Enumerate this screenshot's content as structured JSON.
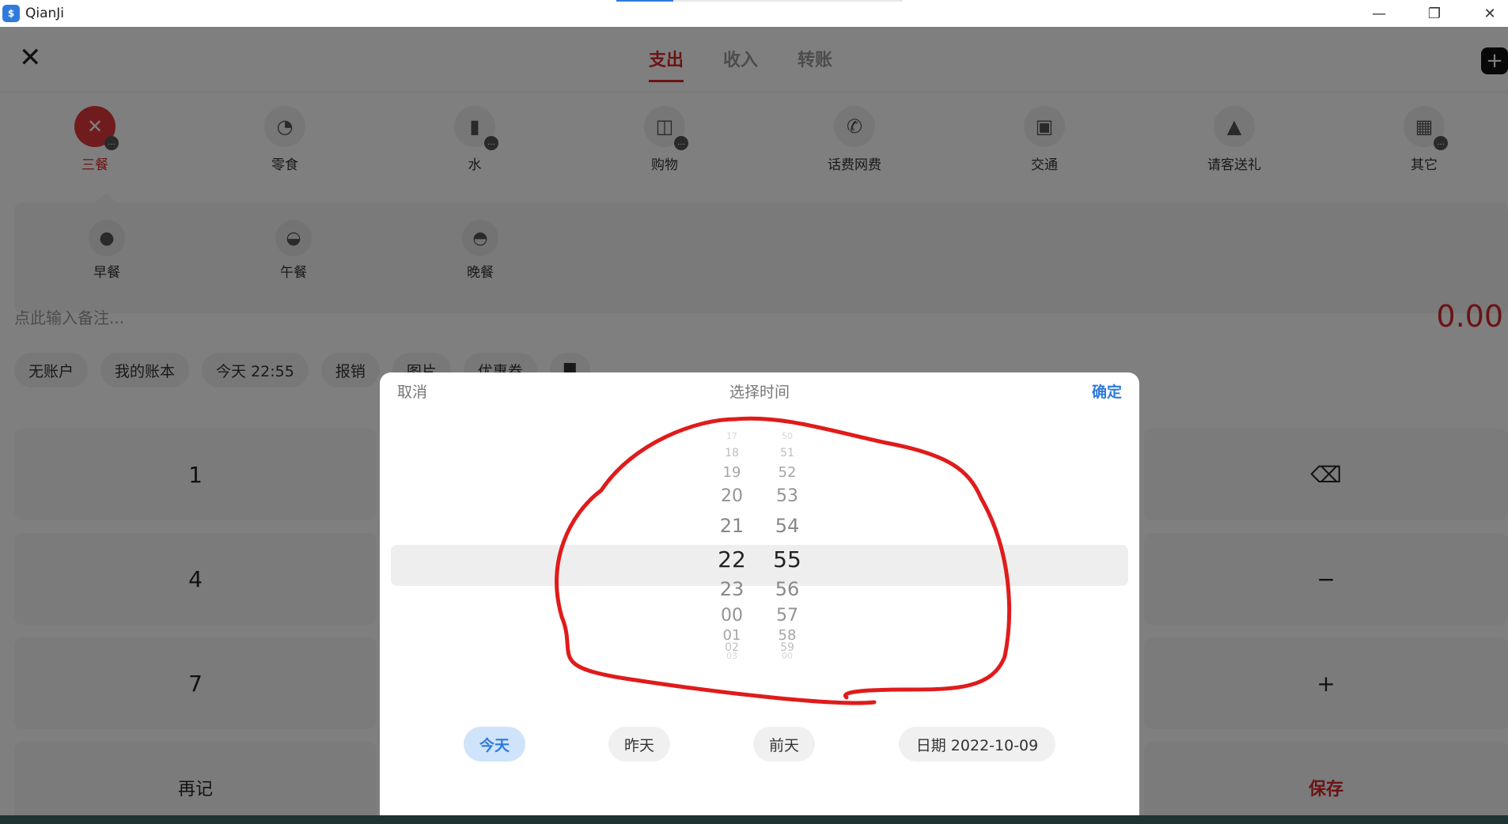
{
  "window": {
    "title": "QianJi",
    "logo_glyph": "$",
    "minimize_glyph": "—",
    "maximize_glyph": "❐",
    "close_glyph": "✕"
  },
  "header": {
    "close_glyph": "✕",
    "tabs": [
      "支出",
      "收入",
      "转账"
    ],
    "active_tab": 0,
    "add_glyph": "+"
  },
  "categories": [
    {
      "label": "三餐",
      "icon": "fork-knife-icon",
      "glyph": "✕"
    },
    {
      "label": "零食",
      "icon": "snack-icon",
      "glyph": "◔"
    },
    {
      "label": "水",
      "icon": "bottle-icon",
      "glyph": "▮"
    },
    {
      "label": "购物",
      "icon": "shopping-bag-icon",
      "glyph": "◫"
    },
    {
      "label": "话费网费",
      "icon": "phone-icon",
      "glyph": "✆"
    },
    {
      "label": "交通",
      "icon": "bus-icon",
      "glyph": "▣"
    },
    {
      "label": "请客送礼",
      "icon": "gift-icon",
      "glyph": "▲"
    },
    {
      "label": "其它",
      "icon": "grid-icon",
      "glyph": "▦"
    }
  ],
  "subcategories": [
    {
      "label": "早餐",
      "icon": "bun-icon",
      "glyph": "●"
    },
    {
      "label": "午餐",
      "icon": "rice-bowl-icon",
      "glyph": "◒"
    },
    {
      "label": "晚餐",
      "icon": "pot-icon",
      "glyph": "◓"
    }
  ],
  "note_placeholder": "点此输入备注...",
  "amount": "0.00",
  "chips": [
    "无账户",
    "我的账本",
    "今天 22:55",
    "报销",
    "图片",
    "优惠券",
    "▇"
  ],
  "keypad": {
    "k1": "1",
    "k4": "4",
    "k7": "7",
    "again": "再记",
    "backspace_glyph": "⌫",
    "minus": "−",
    "plus": "+",
    "save": "保存"
  },
  "dialog": {
    "cancel": "取消",
    "title": "选择时间",
    "confirm": "确定",
    "hours": [
      "17",
      "18",
      "19",
      "20",
      "21",
      "22",
      "23",
      "00",
      "01",
      "02",
      "03"
    ],
    "minutes": [
      "50",
      "51",
      "52",
      "53",
      "54",
      "55",
      "56",
      "57",
      "58",
      "59",
      "00"
    ],
    "selected_hour": "22",
    "selected_minute": "55",
    "quick_days": [
      "今天",
      "昨天",
      "前天"
    ],
    "date_label": "日期 2022-10-09",
    "active_day": "今天"
  },
  "colors": {
    "accent_red": "#d6262b",
    "accent_blue": "#2f7bdc",
    "annotation_red": "#e01b1b"
  }
}
